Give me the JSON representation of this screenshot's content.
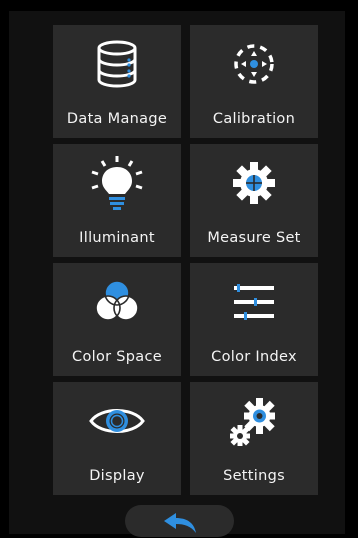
{
  "menu": {
    "tiles": [
      {
        "label": "Data Manage",
        "icon": "database-icon"
      },
      {
        "label": "Calibration",
        "icon": "calibration-icon"
      },
      {
        "label": "Illuminant",
        "icon": "lightbulb-icon"
      },
      {
        "label": "Measure Set",
        "icon": "measure-gear-icon"
      },
      {
        "label": "Color Space",
        "icon": "color-space-icon"
      },
      {
        "label": "Color Index",
        "icon": "color-index-icon"
      },
      {
        "label": "Display",
        "icon": "eye-icon"
      },
      {
        "label": "Settings",
        "icon": "settings-gears-icon"
      }
    ]
  },
  "navigation": {
    "back_icon": "back-arrow-icon"
  },
  "colors": {
    "accent": "#2f8fe0",
    "tile_bg": "#2b2b2b",
    "icon": "#ffffff"
  }
}
